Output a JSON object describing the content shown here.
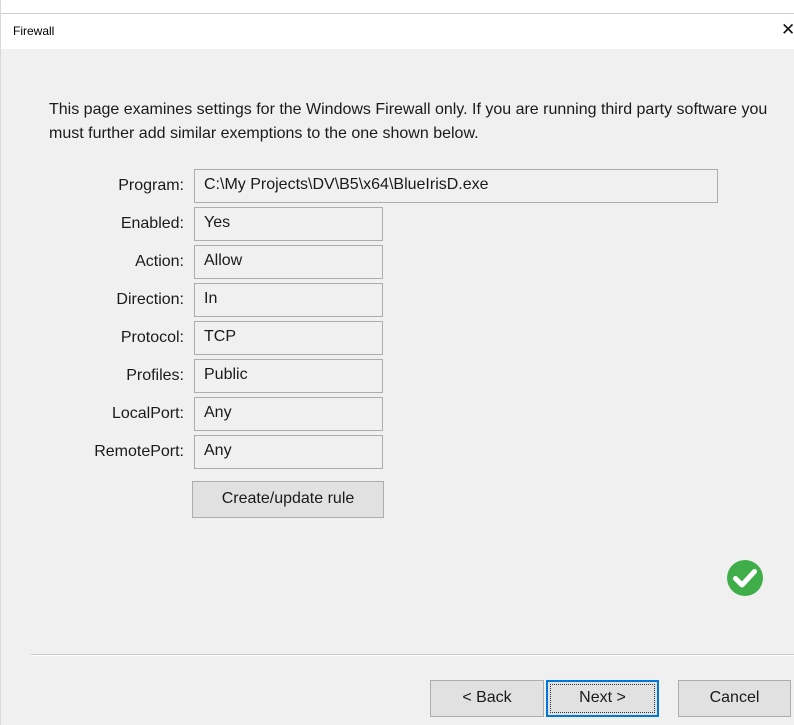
{
  "window": {
    "title": "Firewall",
    "close_glyph": "✕"
  },
  "intro_text": "This page examines settings for the Windows Firewall only.  If you are running third party software you must further add similar exemptions to the one shown below.",
  "fields": {
    "program": {
      "label": "Program:",
      "value": "C:\\My Projects\\DV\\B5\\x64\\BlueIrisD.exe"
    },
    "enabled": {
      "label": "Enabled:",
      "value": "Yes"
    },
    "action": {
      "label": "Action:",
      "value": "Allow"
    },
    "direction": {
      "label": "Direction:",
      "value": "In"
    },
    "protocol": {
      "label": "Protocol:",
      "value": "TCP"
    },
    "profiles": {
      "label": "Profiles:",
      "value": "Public"
    },
    "localport": {
      "label": "LocalPort:",
      "value": "Any"
    },
    "remoteport": {
      "label": "RemotePort:",
      "value": "Any"
    }
  },
  "buttons": {
    "create_update_rule": "Create/update rule",
    "back": "< Back",
    "next": "Next >",
    "cancel": "Cancel"
  },
  "status_icon": {
    "name": "check-circle-icon",
    "color": "#3fae49"
  }
}
